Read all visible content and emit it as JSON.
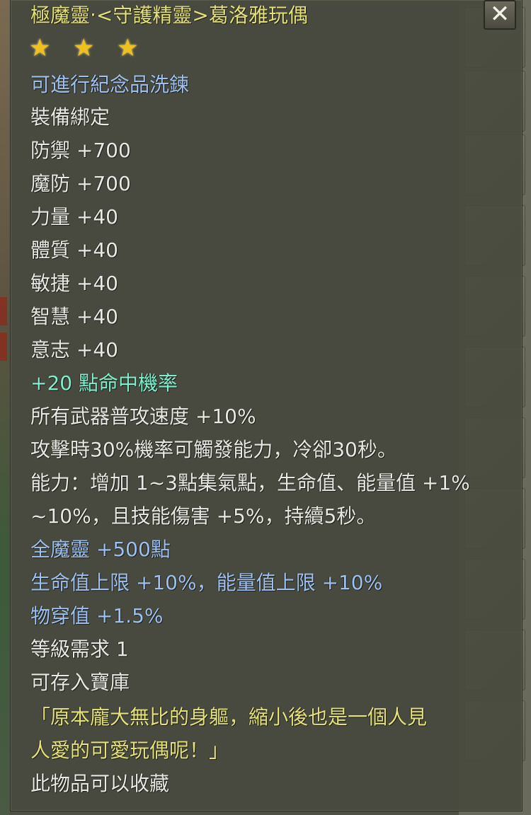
{
  "item": {
    "title": "極魔靈‧<守護精靈>葛洛雅玩偶",
    "star_count": 3,
    "lines": [
      {
        "text": "可進行紀念品洗鍊",
        "color": "blue"
      },
      {
        "text": "裝備綁定",
        "color": "white"
      },
      {
        "text": "防禦 +700",
        "color": "white"
      },
      {
        "text": "魔防 +700",
        "color": "white"
      },
      {
        "text": "力量 +40",
        "color": "white"
      },
      {
        "text": "體質 +40",
        "color": "white"
      },
      {
        "text": "敏捷 +40",
        "color": "white"
      },
      {
        "text": "智慧 +40",
        "color": "white"
      },
      {
        "text": "意志 +40",
        "color": "white"
      },
      {
        "text": "+20 點命中機率",
        "color": "cyan"
      },
      {
        "text": "所有武器普攻速度 +10%",
        "color": "white"
      },
      {
        "text": "攻擊時30%機率可觸發能力，冷卻30秒。",
        "color": "white"
      },
      {
        "text": "能力：增加 1~3點集氣點，生命值、能量值 +1%",
        "color": "white"
      },
      {
        "text": "~10%，且技能傷害 +5%，持續5秒。",
        "color": "white"
      },
      {
        "text": "全魔靈 +500點",
        "color": "blue"
      },
      {
        "text": "生命值上限 +10%，能量值上限 +10%",
        "color": "blue"
      },
      {
        "text": "物穿值 +1.5%",
        "color": "blue"
      },
      {
        "text": "等級需求 1",
        "color": "white"
      },
      {
        "text": "可存入寶庫",
        "color": "white"
      },
      {
        "text": "「原本龐大無比的身軀，縮小後也是一個人見",
        "color": "yellow"
      },
      {
        "text": "人愛的可愛玩偶呢！」",
        "color": "yellow"
      },
      {
        "text": "此物品可以收藏",
        "color": "white"
      }
    ]
  },
  "close_label": "✕",
  "star_glyph": "★",
  "colors": {
    "title": "#e4e07a",
    "blue": "#9ec0f0",
    "cyan": "#7ef0d0",
    "white": "#e8e8e4",
    "star": "#f0c020"
  }
}
